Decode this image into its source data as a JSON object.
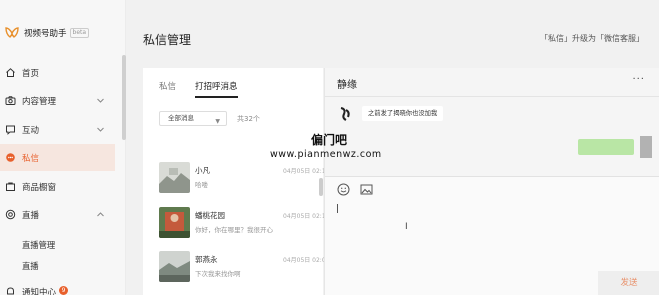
{
  "app": {
    "title": "视频号助手",
    "beta": "beta"
  },
  "sidebar": {
    "items": [
      {
        "label": "首页",
        "icon": "home-icon"
      },
      {
        "label": "内容管理",
        "icon": "camera-icon",
        "expandable": true
      },
      {
        "label": "互动",
        "icon": "message-icon",
        "expandable": true
      },
      {
        "label": "私信",
        "icon": "chat-bubble-icon",
        "active": true
      },
      {
        "label": "商品橱窗",
        "icon": "shop-icon"
      },
      {
        "label": "直播",
        "icon": "live-icon",
        "expandable": true,
        "expanded": true
      },
      {
        "label": "直播管理",
        "sub": true
      },
      {
        "label": "直播"
      },
      {
        "label": "通知中心",
        "icon": "bell-icon",
        "badge": "9"
      }
    ]
  },
  "header": {
    "title": "私信管理",
    "note": "「私信」升级为「微信客服」"
  },
  "list": {
    "tabs": [
      "私信",
      "打招呼消息"
    ],
    "active_tab": "打招呼消息",
    "filter": "全部消息",
    "count": "共32个",
    "items": [
      {
        "name": "小凡",
        "preview": "哈喽",
        "time": "04月05日 02:16"
      },
      {
        "name": "蟠桃花园",
        "preview": "你好，你在哪里？我很开心",
        "time": "04月05日 02:16"
      },
      {
        "name": "郭燕永",
        "preview": "下次我来找你啊",
        "time": "04月05日 02:04"
      }
    ]
  },
  "chat": {
    "name": "静缘",
    "more": "···",
    "incoming_message": "之前发了揭晓你也没加我",
    "send_label": "发送"
  },
  "watermark": {
    "title": "偏门吧",
    "url": "www.pianmenwz.com"
  },
  "colors": {
    "accent": "#e8602c",
    "active_bg": "#f6e6df",
    "sent_bubble": "#aee396"
  }
}
